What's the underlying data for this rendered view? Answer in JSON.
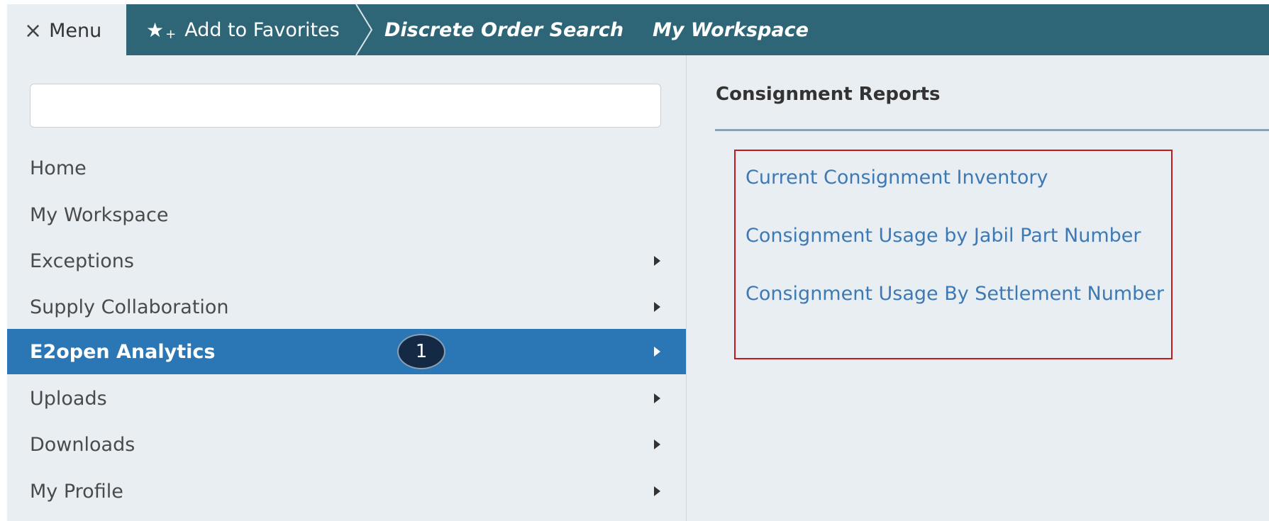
{
  "topbar": {
    "menu_label": "Menu",
    "close_glyph": "×",
    "favorites_label": "Add to Favorites",
    "favorites_icon": "star-plus-icon",
    "breadcrumbs": [
      {
        "label": "Discrete Order Search"
      },
      {
        "label": "My Workspace"
      }
    ],
    "color": "#2e6677"
  },
  "sidebar": {
    "search": {
      "value": "",
      "placeholder": ""
    },
    "items": [
      {
        "label": "Home",
        "has_submenu": false
      },
      {
        "label": "My Workspace",
        "has_submenu": false
      },
      {
        "label": "Exceptions",
        "has_submenu": true
      },
      {
        "label": "Supply Collaboration",
        "has_submenu": true
      },
      {
        "label": "E2open Analytics",
        "has_submenu": true,
        "active": true
      },
      {
        "label": "Uploads",
        "has_submenu": true
      },
      {
        "label": "Downloads",
        "has_submenu": true
      },
      {
        "label": "My Profile",
        "has_submenu": true
      }
    ],
    "active_color": "#2b76b4",
    "step_badge": "1"
  },
  "content": {
    "section_title": "Consignment Reports",
    "reports": [
      {
        "label": "Current Consignment Inventory"
      },
      {
        "label": "Consignment Usage by Jabil Part Number"
      },
      {
        "label": "Consignment Usage By Settlement Number"
      }
    ],
    "highlight_color": "#c0191e",
    "link_color": "#3d79b4"
  }
}
